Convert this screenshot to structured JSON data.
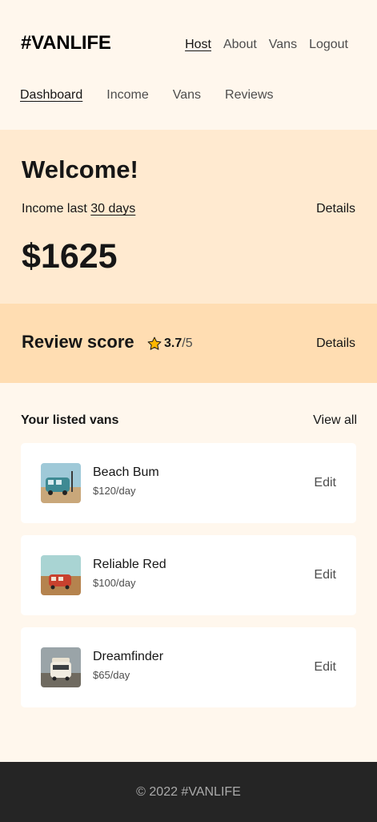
{
  "header": {
    "logo": "#VANLIFE",
    "nav": [
      "Host",
      "About",
      "Vans",
      "Logout"
    ]
  },
  "subnav": [
    "Dashboard",
    "Income",
    "Vans",
    "Reviews"
  ],
  "income": {
    "welcome": "Welcome!",
    "label_prefix": "Income last",
    "range": "30 days",
    "details": "Details",
    "amount": "$1625"
  },
  "review": {
    "title": "Review score",
    "score": "3.7",
    "out_of": "/5",
    "details": "Details",
    "star_icon": "star-icon"
  },
  "listed": {
    "title": "Your listed vans",
    "view_all": "View all",
    "vans": [
      {
        "name": "Beach Bum",
        "price": "$120/day",
        "edit": "Edit"
      },
      {
        "name": "Reliable Red",
        "price": "$100/day",
        "edit": "Edit"
      },
      {
        "name": "Dreamfinder",
        "price": "$65/day",
        "edit": "Edit"
      }
    ]
  },
  "footer": {
    "text": "© 2022 #VANLIFE"
  },
  "colors": {
    "page_bg": "#FFF7ED",
    "income_bg": "#FFEAD0",
    "review_bg": "#FFDDB2",
    "footer_bg": "#252525",
    "star": "#FFB800"
  }
}
